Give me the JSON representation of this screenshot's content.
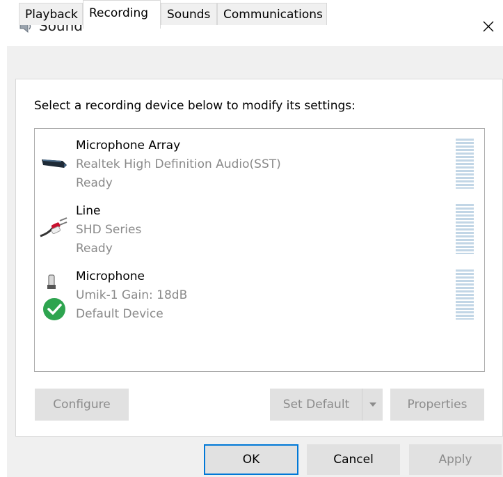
{
  "window": {
    "title": "Sound",
    "close_label": "✕"
  },
  "tabs": [
    {
      "label": "Playback"
    },
    {
      "label": "Recording"
    },
    {
      "label": "Sounds"
    },
    {
      "label": "Communications"
    }
  ],
  "active_tab": "Recording",
  "instruction": "Select a recording device below to modify its settings:",
  "devices": [
    {
      "name": "Microphone Array",
      "line2": "Realtek High Definition Audio(SST)",
      "line3": "Ready",
      "icon": "microphone-array-icon"
    },
    {
      "name": "Line",
      "line2": "SHD Series",
      "line3": "Ready",
      "icon": "line-in-cable-icon"
    },
    {
      "name": "Microphone",
      "line2": "Umik-1  Gain: 18dB",
      "line3": "Default Device",
      "icon": "microphone-icon",
      "is_default": true
    }
  ],
  "buttons": {
    "configure": "Configure",
    "set_default": "Set Default",
    "properties": "Properties",
    "ok": "OK",
    "cancel": "Cancel",
    "apply": "Apply"
  },
  "colors": {
    "accent": "#0078d7",
    "default_check": "#2ea44f",
    "meter": "#c2d6e6"
  }
}
